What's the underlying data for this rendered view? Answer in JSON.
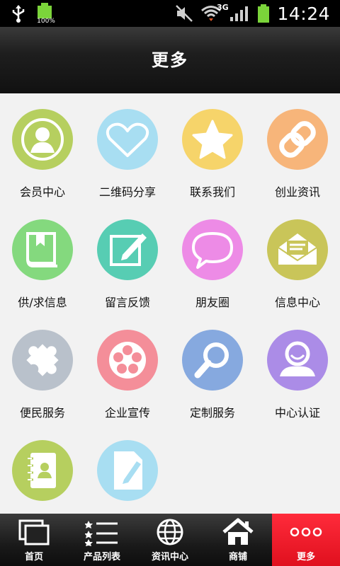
{
  "status_bar": {
    "battery_percent": "100%",
    "network": "3G",
    "time": "14:24",
    "icons": [
      "usb-icon",
      "battery-icon",
      "mute-icon",
      "wifi-icon",
      "signal-icon",
      "battery-icon"
    ]
  },
  "header": {
    "title": "更多"
  },
  "grid": {
    "items": [
      {
        "label": "会员中心",
        "icon": "member-icon",
        "color": "#b6cf5f"
      },
      {
        "label": "二维码分享",
        "icon": "heart-icon",
        "color": "#a8def2"
      },
      {
        "label": "联系我们",
        "icon": "star-icon",
        "color": "#f6d46a"
      },
      {
        "label": "创业资讯",
        "icon": "link-icon",
        "color": "#f7b57a"
      },
      {
        "label": "供/求信息",
        "icon": "book-icon",
        "color": "#84d97e"
      },
      {
        "label": "留言反馈",
        "icon": "edit-icon",
        "color": "#57cdb3"
      },
      {
        "label": "朋友圈",
        "icon": "chat-bubble-icon",
        "color": "#ed8be6"
      },
      {
        "label": "信息中心",
        "icon": "mail-icon",
        "color": "#c9c559"
      },
      {
        "label": "便民服务",
        "icon": "puzzle-icon",
        "color": "#b9c1cb"
      },
      {
        "label": "企业宣传",
        "icon": "film-reel-icon",
        "color": "#f48e99"
      },
      {
        "label": "定制服务",
        "icon": "magnifier-icon",
        "color": "#86a9df"
      },
      {
        "label": "中心认证",
        "icon": "user-icon",
        "color": "#ab8ce7"
      },
      {
        "label": "",
        "icon": "contacts-book-icon",
        "color": "#b6cf5f"
      },
      {
        "label": "",
        "icon": "document-edit-icon",
        "color": "#a8def2"
      }
    ]
  },
  "tabbar": {
    "tabs": [
      {
        "label": "首页",
        "icon": "windows-icon"
      },
      {
        "label": "产品列表",
        "icon": "list-icon"
      },
      {
        "label": "资讯中心",
        "icon": "globe-icon"
      },
      {
        "label": "商铺",
        "icon": "home-icon"
      },
      {
        "label": "更多",
        "icon": "more-icon",
        "active": true
      }
    ]
  }
}
